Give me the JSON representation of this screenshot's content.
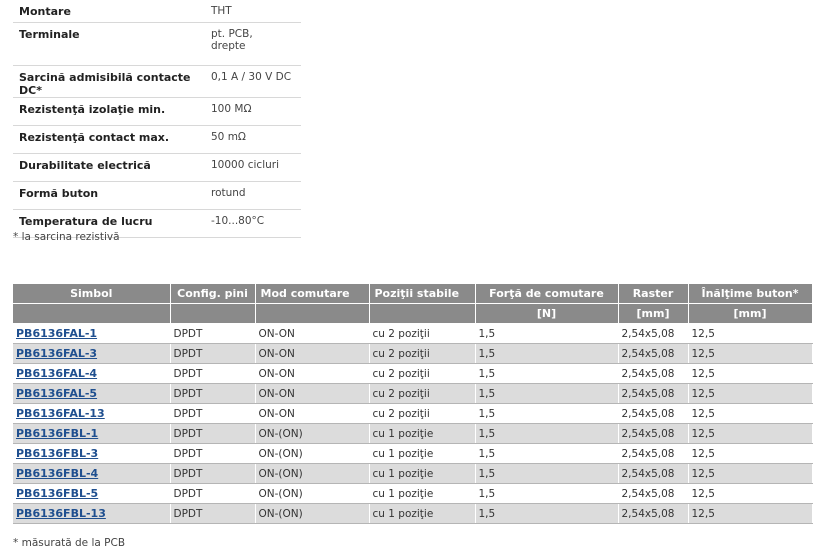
{
  "specs": [
    {
      "label": "Montare",
      "value": "THT"
    },
    {
      "label": "Terminale",
      "value": "pt. PCB,",
      "value2": "drepte"
    },
    {
      "label": "Sarcină admisibilă contacte DC*",
      "value": "0,1 A / 30 V DC"
    },
    {
      "label": "Rezistenţă izolaţie min.",
      "value": "100 MΩ"
    },
    {
      "label": "Rezistenţă contact max.",
      "value": "50 mΩ"
    },
    {
      "label": "Durabilitate electrică",
      "value": "10000 cicluri"
    },
    {
      "label": "Formă buton",
      "value": "rotund"
    },
    {
      "label": "Temperatura de lucru",
      "value": "-10...80°C"
    }
  ],
  "spec_note": "* la sarcina rezistivă",
  "table": {
    "headers": [
      "Simbol",
      "Config. pini",
      "Mod comutare",
      "Poziţii stabile",
      "Forţă de comutare",
      "Raster",
      "Înălţime buton*"
    ],
    "units": [
      "",
      "",
      "",
      "",
      "[N]",
      "[mm]",
      "[mm]"
    ],
    "rows": [
      [
        "PB6136FAL-1",
        "DPDT",
        "ON-ON",
        "cu 2 poziţii",
        "1,5",
        "2,54x5,08",
        "12,5"
      ],
      [
        "PB6136FAL-3",
        "DPDT",
        "ON-ON",
        "cu 2 poziţii",
        "1,5",
        "2,54x5,08",
        "12,5"
      ],
      [
        "PB6136FAL-4",
        "DPDT",
        "ON-ON",
        "cu 2 poziţii",
        "1,5",
        "2,54x5,08",
        "12,5"
      ],
      [
        "PB6136FAL-5",
        "DPDT",
        "ON-ON",
        "cu 2 poziţii",
        "1,5",
        "2,54x5,08",
        "12,5"
      ],
      [
        "PB6136FAL-13",
        "DPDT",
        "ON-ON",
        "cu 2 poziţii",
        "1,5",
        "2,54x5,08",
        "12,5"
      ],
      [
        "PB6136FBL-1",
        "DPDT",
        "ON-(ON)",
        "cu 1 poziţie",
        "1,5",
        "2,54x5,08",
        "12,5"
      ],
      [
        "PB6136FBL-3",
        "DPDT",
        "ON-(ON)",
        "cu 1 poziţie",
        "1,5",
        "2,54x5,08",
        "12,5"
      ],
      [
        "PB6136FBL-4",
        "DPDT",
        "ON-(ON)",
        "cu 1 poziţie",
        "1,5",
        "2,54x5,08",
        "12,5"
      ],
      [
        "PB6136FBL-5",
        "DPDT",
        "ON-(ON)",
        "cu 1 poziţie",
        "1,5",
        "2,54x5,08",
        "12,5"
      ],
      [
        "PB6136FBL-13",
        "DPDT",
        "ON-(ON)",
        "cu 1 poziţie",
        "1,5",
        "2,54x5,08",
        "12,5"
      ]
    ]
  },
  "table_note": "* măsurată de la PCB",
  "colors": {
    "header_bg": "#8a8a8a",
    "alt_row_bg": "#dcdcdc",
    "link": "#1f4f8f"
  }
}
